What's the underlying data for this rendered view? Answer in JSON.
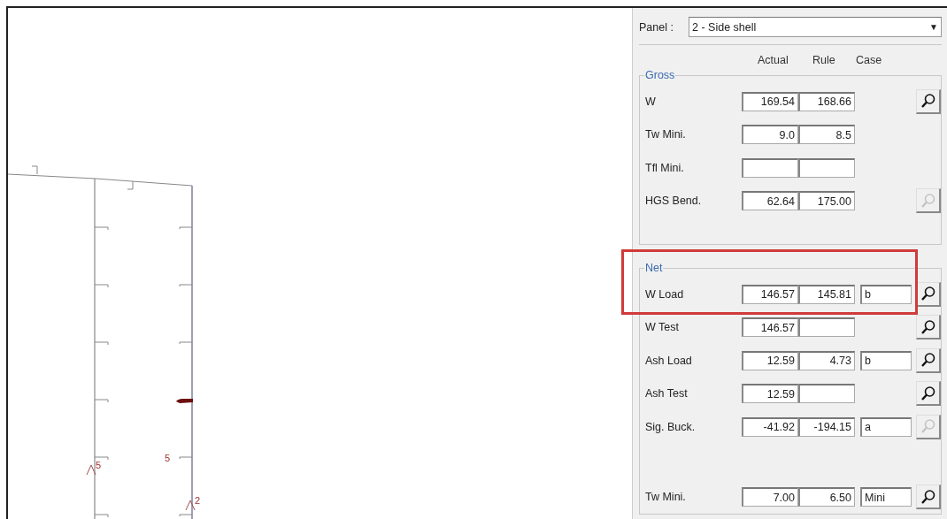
{
  "panel_selector": {
    "label": "Panel :",
    "value": "2 - Side shell",
    "arrow": "▼"
  },
  "columns": [
    "Actual",
    "Rule",
    "Case"
  ],
  "groups": [
    {
      "title": "Gross",
      "rows": [
        {
          "label": "W",
          "kind": "pair",
          "actual": "169.54",
          "rule": "168.66",
          "button": {
            "disabled": false
          },
          "highlighted": false
        },
        {
          "label": "Tw Mini.",
          "kind": "pair",
          "actual": "9.0",
          "rule": "8.5",
          "highlighted": false
        },
        {
          "label": "Tfl Mini.",
          "kind": "pair",
          "highlighted": false
        },
        {
          "label": "HGS Bend.",
          "kind": "pair",
          "actual": "62.64",
          "rule": "175.00",
          "button": {
            "disabled": true
          },
          "highlighted": false
        }
      ]
    },
    {
      "title": "Net",
      "rows": [
        {
          "label": "W Load",
          "kind": "triple",
          "actual": "146.57",
          "rule": "145.81",
          "case": "b",
          "button": {
            "disabled": false
          },
          "highlighted": true
        },
        {
          "label": "W Test",
          "kind": "pair",
          "actual": "146.57",
          "button": {
            "disabled": false
          },
          "highlighted": false
        },
        {
          "label": "Ash Load",
          "kind": "triple",
          "actual": "12.59",
          "rule": "4.73",
          "case": "b",
          "button": {
            "disabled": false
          },
          "highlighted": false
        },
        {
          "label": "Ash Test",
          "kind": "pair",
          "actual": "12.59",
          "button": {
            "disabled": false
          },
          "highlighted": false
        },
        {
          "label": "Sig. Buck.",
          "kind": "triple",
          "actual": "-41.92",
          "rule": "-194.15",
          "case": "a",
          "button": {
            "disabled": true
          },
          "highlighted": false
        },
        {
          "label": "Tw Mini.",
          "kind": "triple",
          "actual": "7.00",
          "rule": "6.50",
          "case": "Mini",
          "button": {
            "disabled": false
          },
          "highlighted": false
        }
      ]
    }
  ],
  "drawing_labels": [
    {
      "text": "5",
      "kind": "arrow"
    },
    {
      "text": "5",
      "kind": "plain"
    },
    {
      "text": "2",
      "kind": "arrow"
    }
  ]
}
